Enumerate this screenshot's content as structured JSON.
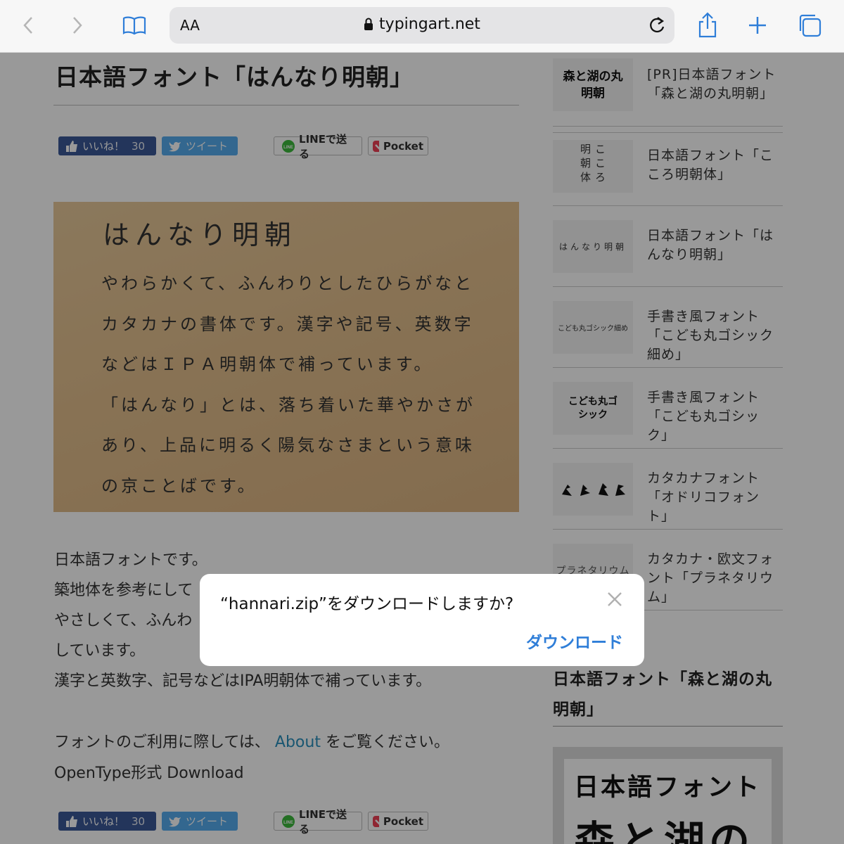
{
  "browser": {
    "text_size_label": "AA",
    "url": "typingart.net"
  },
  "article": {
    "title": "日本語フォント「はんなり明朝」",
    "share": {
      "like_label": "いいね！",
      "like_count": "30",
      "tweet_label": "ツイート",
      "line_label": "LINEで送る",
      "pocket_label": "Pocket"
    },
    "sample": {
      "heading": "はんなり明朝",
      "lines": [
        "やわらかくて、ふんわりとしたひらがなと",
        "カタカナの書体です。漢字や記号、英数字",
        "などはＩＰＡ明朝体で補っています。",
        "「はんなり」とは、落ち着いた華やかさが",
        "あり、上品に明るく陽気なさまという意味",
        "の京ことばです。"
      ]
    },
    "paragraphs": [
      "日本語フォントです。",
      "築地体を参考にして",
      "やさしくて、ふんわ",
      "しています。",
      "漢字と英数字、記号などはIPA明朝体で補っています。"
    ],
    "usage_prefix": "フォントのご利用に際しては、",
    "about_link": "About",
    "usage_suffix": "をご覧ください。",
    "download_text": "OpenType形式 Download"
  },
  "sidebar": {
    "items": [
      {
        "thumb": "森と湖の丸明朝",
        "title": "[PR]日本語フォント「森と湖の丸明朝」"
      },
      {
        "thumb": "こころ明朝体",
        "title": "日本語フォント「こころ明朝体」"
      },
      {
        "thumb": "はんなり明朝",
        "title": "日本語フォント「はんなり明朝」"
      },
      {
        "thumb": "こども丸ゴシック細め",
        "title": "手書き風フォント「こども丸ゴシック細め」"
      },
      {
        "thumb": "こども丸ゴシック",
        "title": "手書き風フォント「こども丸ゴシック」"
      },
      {
        "thumb": "オドリコ",
        "title": "カタカナフォント「オドリコフォント」"
      },
      {
        "thumb": "プラネタリウム",
        "title": "カタカナ・欧文フォント「プラネタリウム」"
      }
    ],
    "section_title": "日本語フォント「森と湖の丸明朝」",
    "banner_line1": "日本語フォント",
    "banner_line2": "森と湖の"
  },
  "dialog": {
    "message": "“hannari.zip”をダウンロードしますか?",
    "download_label": "ダウンロード"
  }
}
